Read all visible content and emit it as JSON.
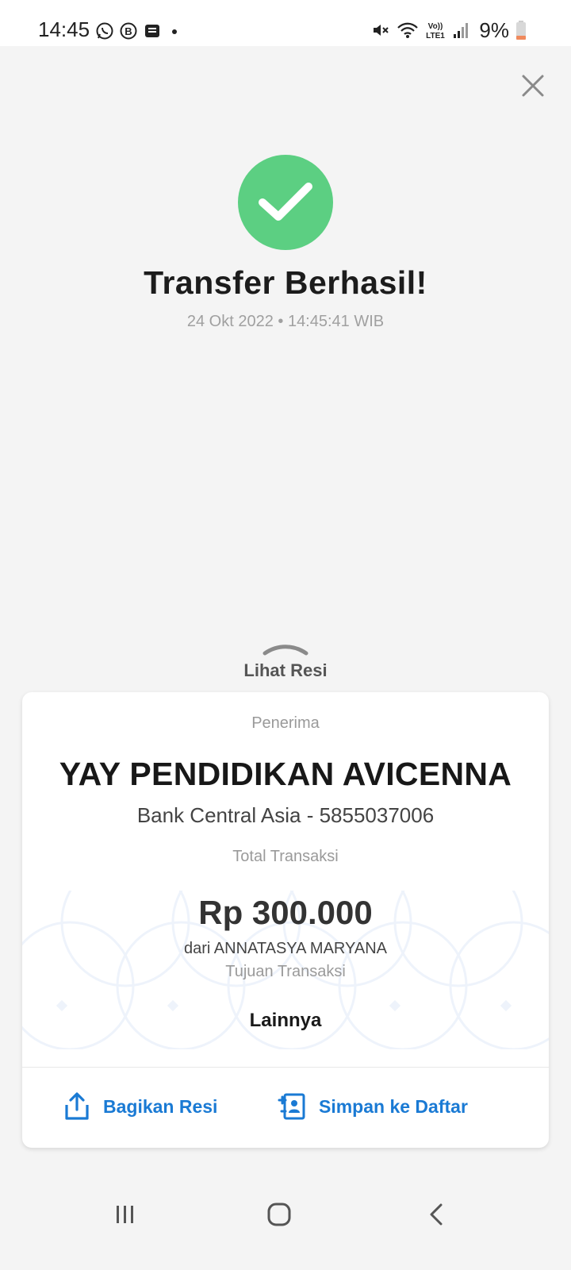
{
  "status_bar": {
    "time": "14:45",
    "battery": "9%",
    "left_icons": [
      "whatsapp-icon",
      "business-icon",
      "message-icon",
      "dot-icon"
    ],
    "right_icons": [
      "mute-icon",
      "wifi-icon",
      "volte-icon",
      "signal-icon",
      "battery-icon"
    ]
  },
  "header": {
    "close_icon": "close-icon"
  },
  "success": {
    "icon": "check-circle-icon",
    "icon_color": "#5ccf82",
    "title": "Transfer Berhasil!",
    "timestamp": "24 Okt 2022 • 14:45:41 WIB"
  },
  "receipt_toggle": {
    "label": "Lihat Resi",
    "icon": "chevron-up-icon"
  },
  "receipt": {
    "recipient_label": "Penerima",
    "recipient_name": "YAY PENDIDIKAN AVICENNA",
    "recipient_bank": "Bank Central Asia - 5855037006",
    "total_label": "Total Transaksi",
    "amount": "Rp 300.000",
    "from": "dari ANNATASYA MARYANA",
    "purpose_label": "Tujuan Transaksi",
    "purpose": "Lainnya"
  },
  "actions": {
    "share_label": "Bagikan Resi",
    "share_icon": "share-icon",
    "save_label": "Simpan ke Daftar",
    "save_icon": "contact-add-icon",
    "accent_color": "#1a7ad4"
  },
  "nav_bar": {
    "recent_icon": "recent-apps-icon",
    "home_icon": "home-icon",
    "back_icon": "back-icon"
  }
}
